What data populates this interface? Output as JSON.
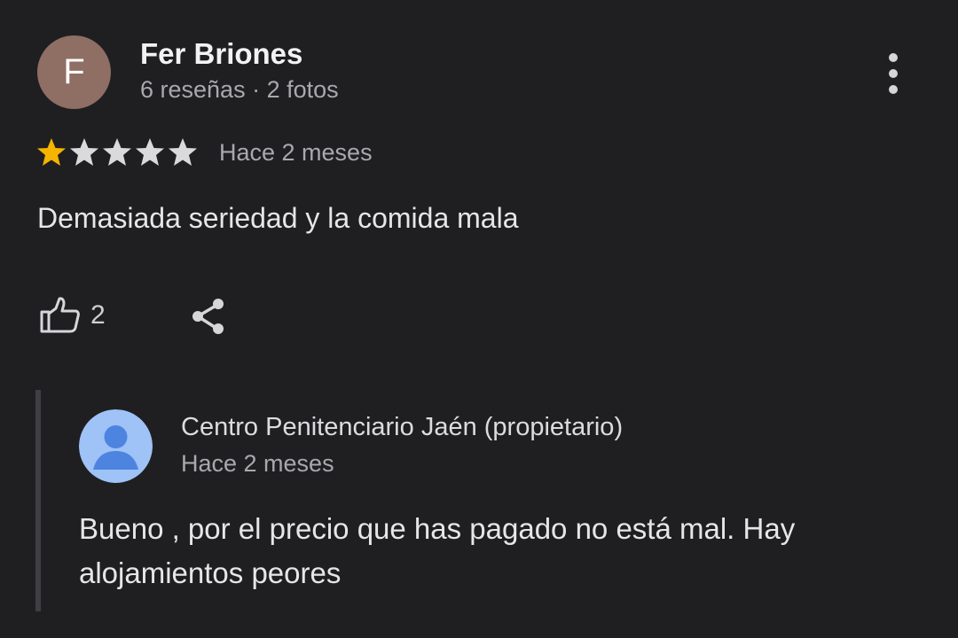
{
  "review": {
    "avatar_letter": "F",
    "avatar_color": "#8f6e63",
    "author_name": "Fer Briones",
    "author_meta": "6 reseñas · 2 fotos",
    "menu_icon": "more-vert-icon",
    "rating": 1,
    "rating_max": 5,
    "star_filled_color": "#f4b400",
    "star_empty_color": "#dadadd",
    "date": "Hace 2 meses",
    "text": "Demasiada seriedad y la comida mala",
    "like_icon": "thumb-up-icon",
    "like_count": "2",
    "share_icon": "share-icon"
  },
  "owner_reply": {
    "avatar_icon": "person-icon",
    "avatar_color": "#9fc2f7",
    "name": "Centro Penitenciario Jaén (propietario)",
    "date": "Hace 2 meses",
    "text": "Bueno , por el precio que has pagado no está mal. Hay alojamientos peores"
  }
}
